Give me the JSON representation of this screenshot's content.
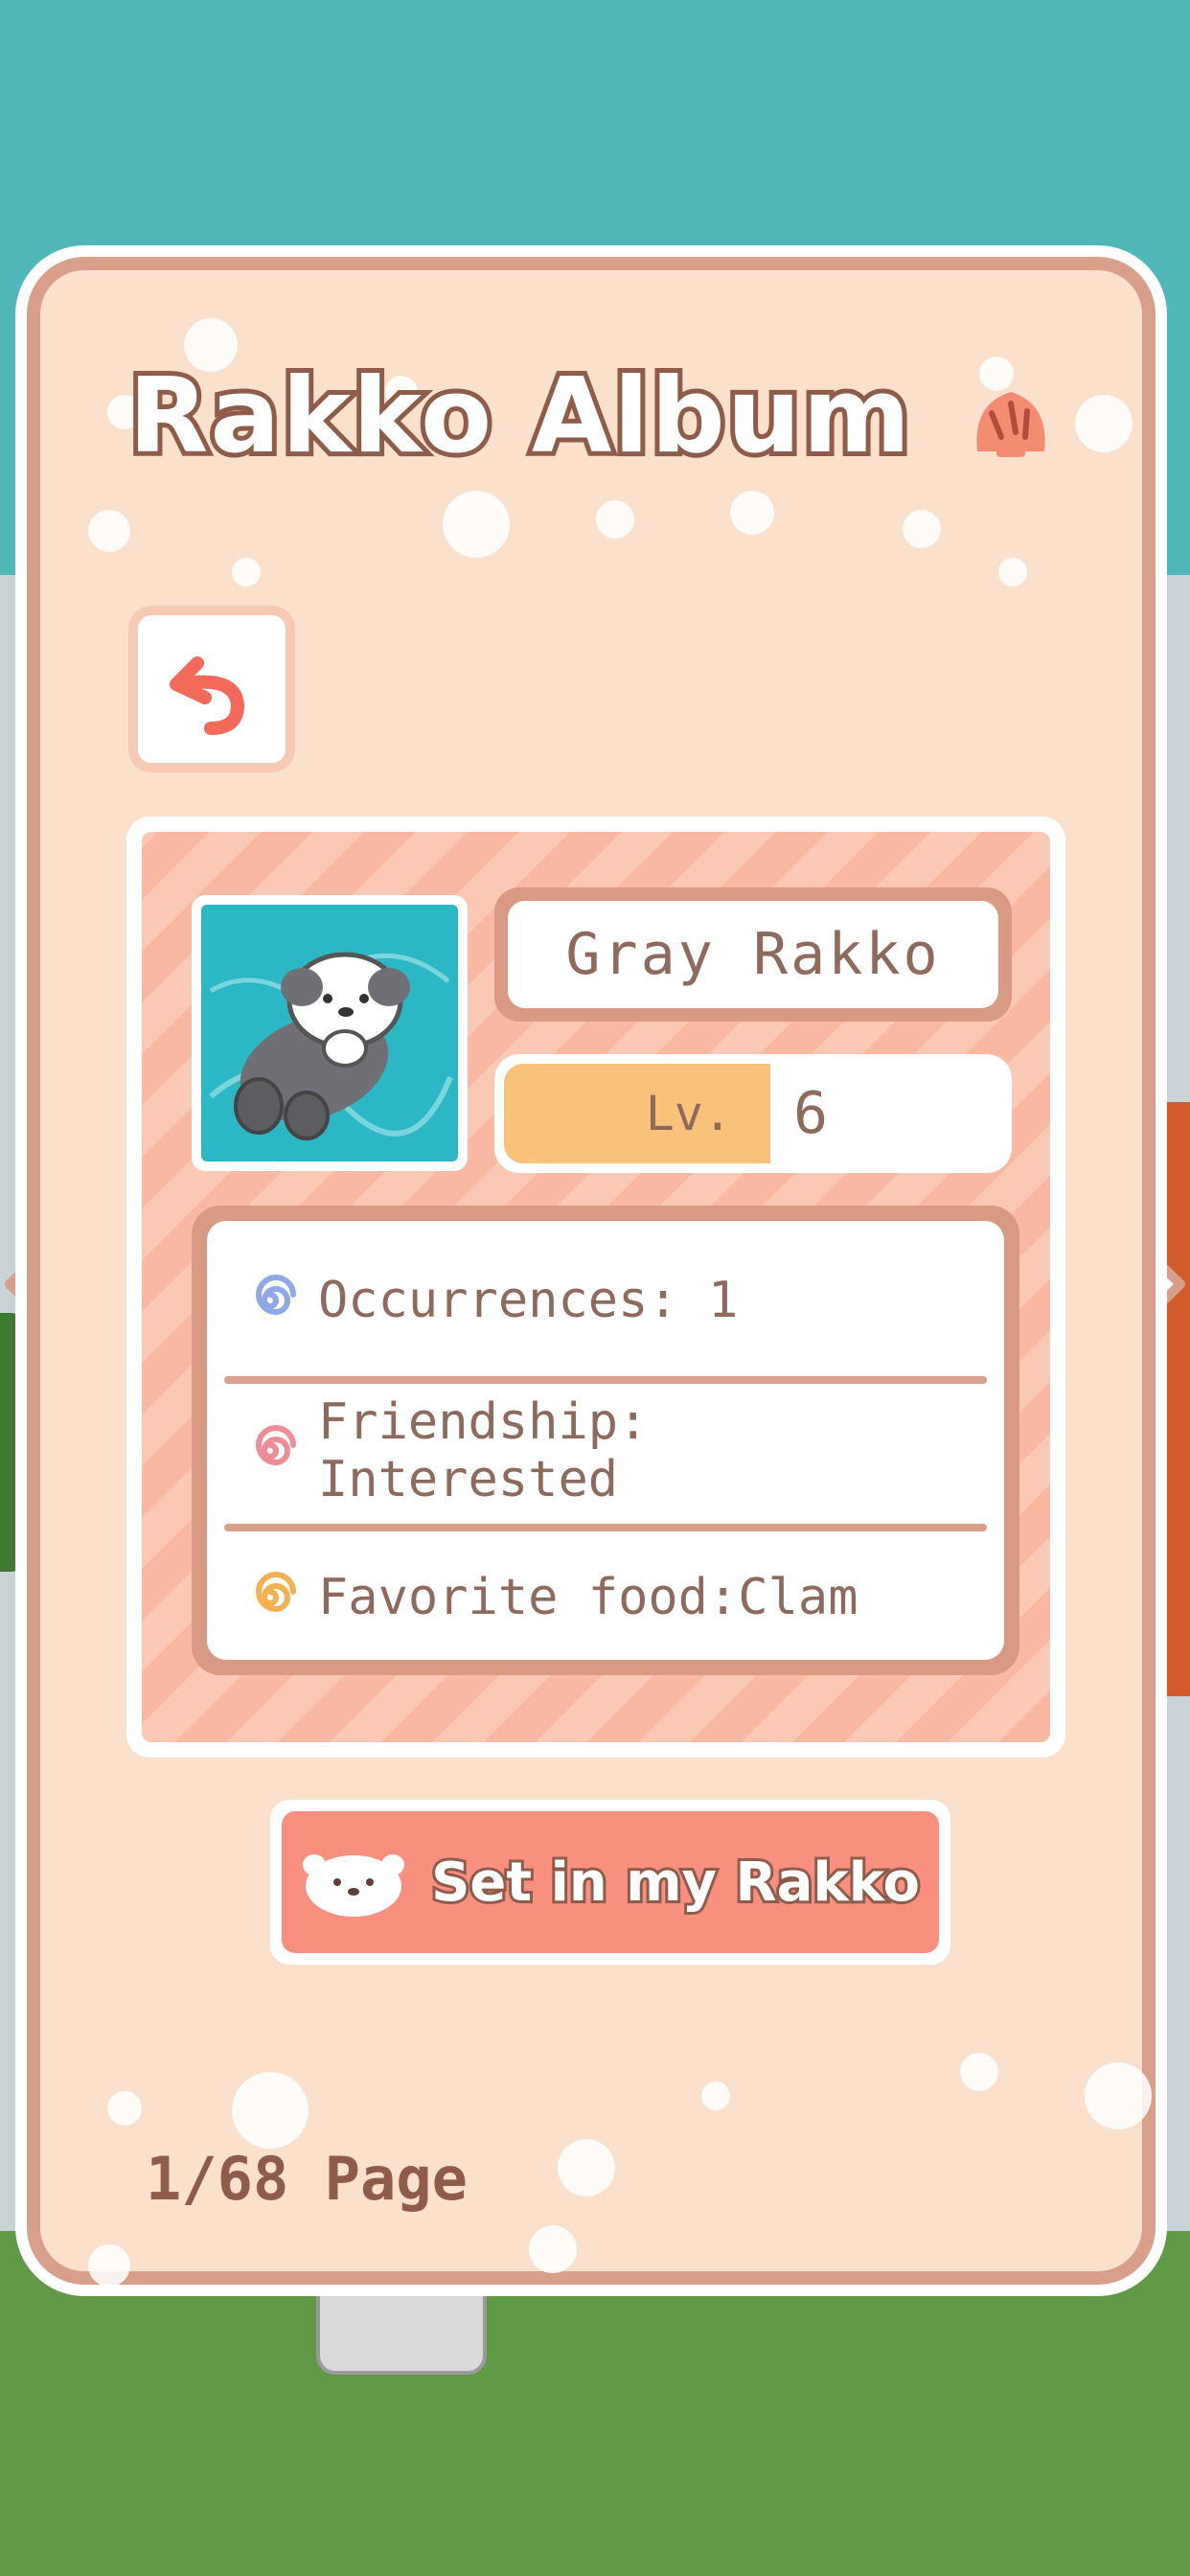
{
  "title": "Rakko Album",
  "back_button": {
    "icon": "undo-arrow-icon"
  },
  "rakko": {
    "name": "Gray Rakko",
    "level_label": "Lv.",
    "level": "6",
    "stats": [
      {
        "icon": "blue-swirl-icon",
        "text": "Occurrences: 1",
        "color": "#8fa8e8"
      },
      {
        "icon": "pink-swirl-icon",
        "text": "Friendship: Interested",
        "color": "#f08c96"
      },
      {
        "icon": "orange-swirl-icon",
        "text": "Favorite food:Clam",
        "color": "#f5b04f"
      }
    ]
  },
  "set_button": {
    "label": "Set in my Rakko"
  },
  "page_indicator": "1/68 Page",
  "colors": {
    "panel_bg": "#fbe0cb",
    "panel_border": "#d8a08a",
    "accent_button": "#f9907f",
    "level_fill": "#f9c27a",
    "text_brown": "#8e5c49",
    "sky": "#4fb6ba"
  }
}
